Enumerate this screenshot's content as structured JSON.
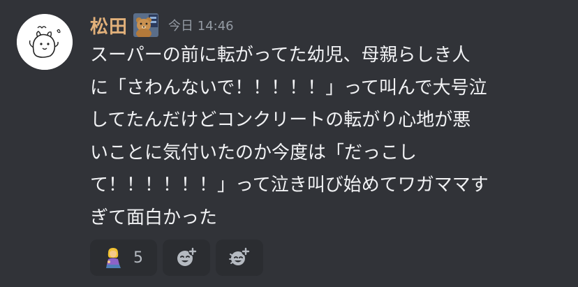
{
  "message": {
    "author": "松田",
    "timestamp": "今日 14:46",
    "text": "スーパーの前に転がってた幼児、母親らしき人\nに「さわんないで！！！！！」って叫んで大号泣\nしてたんだけどコンクリートの転がり心地が悪\nいことに気付いたのか今度は「だっこし\nて！！！！！！」って泣き叫び始めてワガママす\nぎて面白かった",
    "avatar_icon": "doodle-creature-avatar",
    "badge_icon": "teddy-bear-badge-icon"
  },
  "reactions": {
    "items": [
      {
        "emoji_icon": "woman-kneeling-emoji",
        "count": "5"
      }
    ],
    "add_reaction_icon": "add-reaction-icon",
    "add_super_reaction_icon": "add-super-reaction-icon"
  },
  "colors": {
    "background": "#313338",
    "username": "#e1b07a",
    "timestamp": "#949ba4",
    "text": "#f2f3f5",
    "pill": "#2b2d31",
    "icon": "#b5bac1"
  }
}
